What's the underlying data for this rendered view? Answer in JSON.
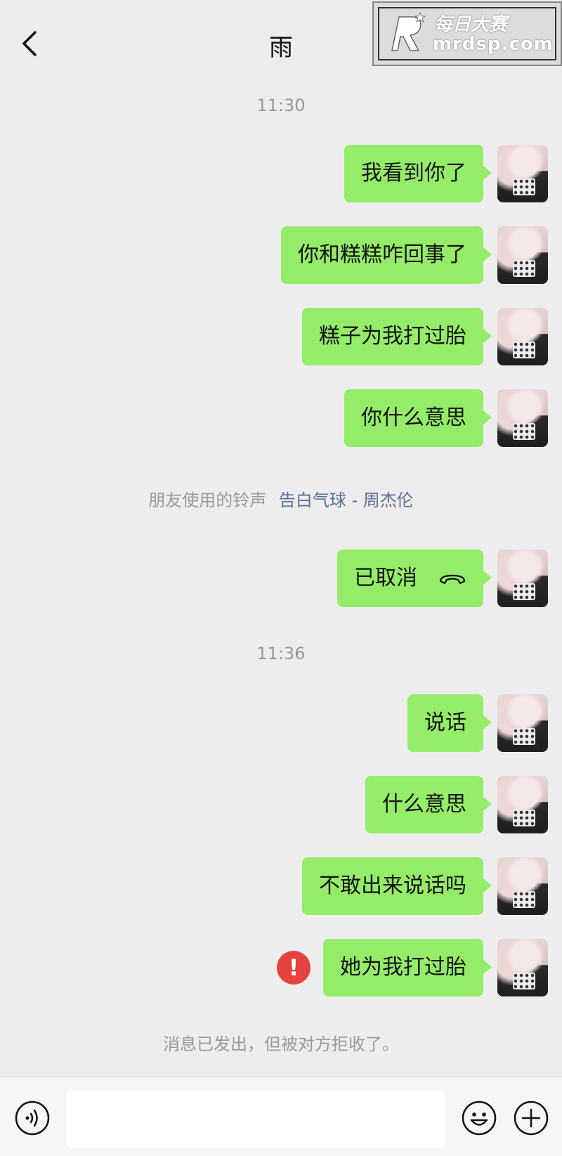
{
  "header": {
    "title": "雨",
    "watermark_brand": "每日大赛",
    "watermark_url": "mrdsp.com"
  },
  "timestamps": [
    "11:30",
    "11:36"
  ],
  "messages": [
    {
      "text": "我看到你了"
    },
    {
      "text": "你和糕糕咋回事了"
    },
    {
      "text": "糕子为我打过胎"
    },
    {
      "text": "你什么意思"
    },
    {
      "text": "已取消",
      "type": "cancelled-call"
    },
    {
      "text": "说话"
    },
    {
      "text": "什么意思"
    },
    {
      "text": "不敢出来说话吗"
    },
    {
      "text": "她为我打过胎",
      "status": "rejected"
    }
  ],
  "ringtone_note": {
    "prefix": "朋友使用的铃声",
    "song": "告白气球 - 周杰伦"
  },
  "rejected_notice": "消息已发出，但被对方拒收了。",
  "colors": {
    "bubble": "#95ec69",
    "background": "#ededed",
    "error": "#e64340",
    "link": "#5a6d96"
  },
  "icons": [
    "back-icon",
    "phone-hangup-icon",
    "error-icon",
    "voice-icon",
    "emoji-icon",
    "plus-icon"
  ]
}
